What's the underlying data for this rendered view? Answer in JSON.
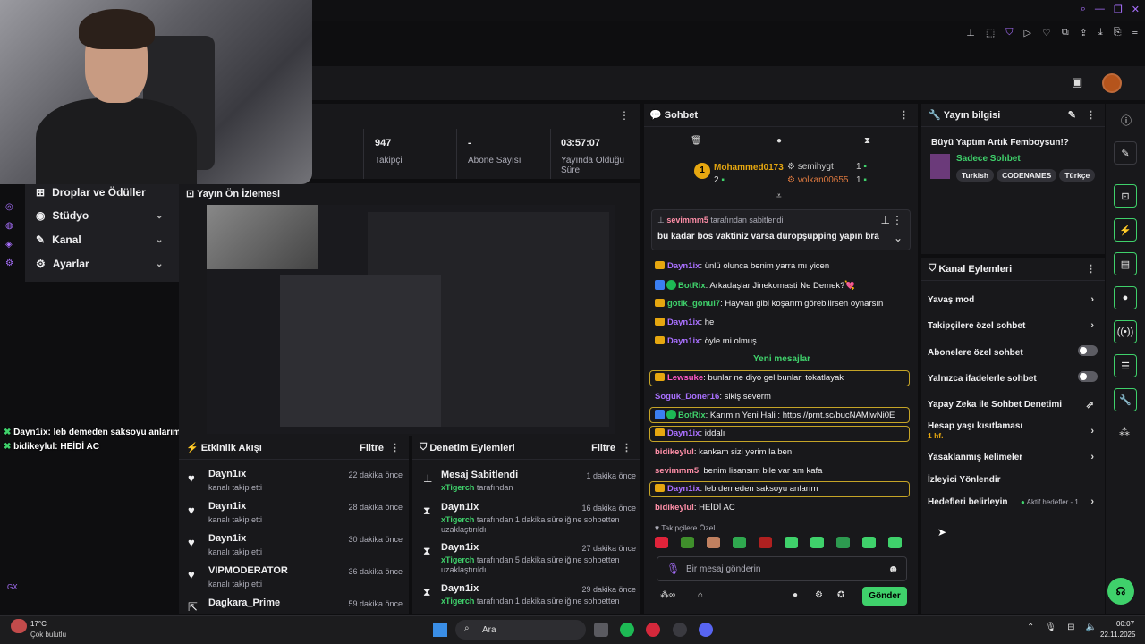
{
  "stats": [
    {
      "value": "947",
      "label": "Takipçi"
    },
    {
      "value": "-",
      "label": "Abone Sayısı"
    },
    {
      "value": "03:57:07",
      "label": "Yayında Olduğu Süre"
    }
  ],
  "nav": {
    "items": [
      {
        "label": "Droplar ve Ödüller"
      },
      {
        "label": "Stüdyo"
      },
      {
        "label": "Kanal"
      },
      {
        "label": "Ayarlar"
      }
    ]
  },
  "overlay_chat": [
    {
      "user": "Dayn1ix",
      "text": ": leb demeden saksoyu anlarım"
    },
    {
      "user": "bidikeylul",
      "text": ": HEİDİ AC"
    }
  ],
  "overlay_gx": "GX",
  "preview": {
    "title": "Yayın Ön İzlemesi"
  },
  "activity": {
    "title": "Etkinlik Akışı",
    "filter": "Filtre",
    "items": [
      {
        "name": "Dayn1ix",
        "sub": "kanalı takip etti",
        "time": "22 dakika önce"
      },
      {
        "name": "Dayn1ix",
        "sub": "kanalı takip etti",
        "time": "28 dakika önce"
      },
      {
        "name": "Dayn1ix",
        "sub": "kanalı takip etti",
        "time": "30 dakika önce"
      },
      {
        "name": "VIPMODERATOR",
        "sub": "kanalı takip etti",
        "time": "36 dakika önce"
      },
      {
        "name": "Dagkara_Prime",
        "sub": "",
        "time": "59 dakika önce"
      }
    ]
  },
  "modlog": {
    "title": "Denetim Eylemleri",
    "filter": "Filtre",
    "items": [
      {
        "icon": "pin",
        "name": "Mesaj Sabitlendi",
        "actor": "xTigerch",
        "sub": " tarafından",
        "time": "1 dakika önce"
      },
      {
        "icon": "timer",
        "name": "Dayn1ix",
        "actor": "xTigerch",
        "sub": " tarafından 1 dakika süreliğine sohbetten uzaklaştırıldı",
        "time": "16 dakika önce"
      },
      {
        "icon": "timer",
        "name": "Dayn1ix",
        "actor": "xTigerch",
        "sub": " tarafından 5 dakika süreliğine sohbetten uzaklaştırıldı",
        "time": "27 dakika önce"
      },
      {
        "icon": "timer",
        "name": "Dayn1ix",
        "actor": "xTigerch",
        "sub": " tarafından 1 dakika süreliğine sohbetten",
        "time": "29 dakika önce"
      }
    ]
  },
  "chat": {
    "title": "Sohbet",
    "leaders": {
      "first": "Mohammed0173",
      "first_count": "2",
      "second": "semihygt",
      "second_count": "1",
      "third": "volkan00655",
      "third_count": "1",
      "rank": "1"
    },
    "pinned_by": "sevimmm5",
    "pinned_by_suffix": " tarafından sabitlendi",
    "pinned_text": "bu kadar bos vaktiniz varsa duropşupping yapın bra",
    "messages": [
      {
        "user": "Dayn1ix",
        "text": ": ünlü olunca benim yarra mı yicen",
        "color": "#a970ff"
      },
      {
        "user": "BotRix",
        "text": ": Arkadaşlar Jinekomasti Ne Demek?💘",
        "color": "#3fd16b"
      },
      {
        "user": "gotik_gonul7",
        "text": ": Hayvan gibi koşarım görebilirsen oynarsın",
        "color": "#3fd16b"
      },
      {
        "user": "Dayn1ix",
        "text": ": he",
        "color": "#a970ff"
      },
      {
        "user": "Dayn1ix",
        "text": ": öyle mi olmuş",
        "color": "#a970ff"
      }
    ],
    "new_label": "Yeni mesajlar",
    "messages2": [
      {
        "user": "Lewsuke",
        "text": ": bunlar ne diyo gel bunlari tokatlayak",
        "color": "#ff5ac8"
      },
      {
        "user": "Soguk_Doner16",
        "text": ": sikiş severm",
        "color": "#a970ff"
      },
      {
        "user": "BotRix",
        "text": ": Karımın Yeni Hali : ",
        "link": "https://prnt.sc/bucNAMlwNi0E",
        "color": "#3fd16b"
      },
      {
        "user": "Dayn1ix",
        "text": ": iddalı",
        "color": "#a970ff"
      },
      {
        "user": "bidikeylul",
        "text": ": kankam sizi yerim la ben",
        "color": "#ff8fa8"
      },
      {
        "user": "sevimmm5",
        "text": ": benim lisansım bile var am kafa",
        "color": "#ff8fa8"
      },
      {
        "user": "Dayn1ix",
        "text": ": leb demeden saksoyu anlarım",
        "color": "#a970ff"
      },
      {
        "user": "bidikeylul",
        "text": ": HEİDİ AC",
        "color": "#ff8fa8"
      }
    ],
    "followers_only": "♥ Takipçilere Özel",
    "placeholder": "Bir mesaj gönderin",
    "send": "Gönder"
  },
  "info": {
    "title": "Yayın bilgisi",
    "stream_title": "Büyü Yaptım Artık Femboysun!?",
    "category": "Sadece Sohbet",
    "tags": [
      "Turkish",
      "CODENAMES",
      "Türkçe"
    ]
  },
  "actions": {
    "title": "Kanal Eylemleri",
    "items": [
      {
        "label": "Yavaş mod",
        "type": "chev"
      },
      {
        "label": "Takipçilere özel sohbet",
        "type": "chev"
      },
      {
        "label": "Abonelere özel sohbet",
        "type": "toggle"
      },
      {
        "label": "Yalnızca ifadelerle sohbet",
        "type": "toggle"
      },
      {
        "label": "Yapay Zeka ile Sohbet Denetimi",
        "type": "ext"
      },
      {
        "label": "Hesap yaşı kısıtlaması",
        "type": "chev",
        "sub": "1 hf."
      },
      {
        "label": "Yasaklanmış kelimeler",
        "type": "chev"
      },
      {
        "label": "İzleyici Yönlendir",
        "type": "none"
      },
      {
        "label": "Hedefleri belirleyin",
        "type": "chev",
        "extra": "Aktif hedefler - 1"
      }
    ]
  },
  "taskbar": {
    "weather_temp": "17°C",
    "weather_desc": "Çok bulutlu",
    "search": "Ara",
    "time": "00:07",
    "date": "22.11.2025"
  },
  "colors": {
    "accent": "#3fd16b",
    "purple": "#a970ff",
    "panel": "#18181b",
    "bg": "#0e0e10"
  }
}
